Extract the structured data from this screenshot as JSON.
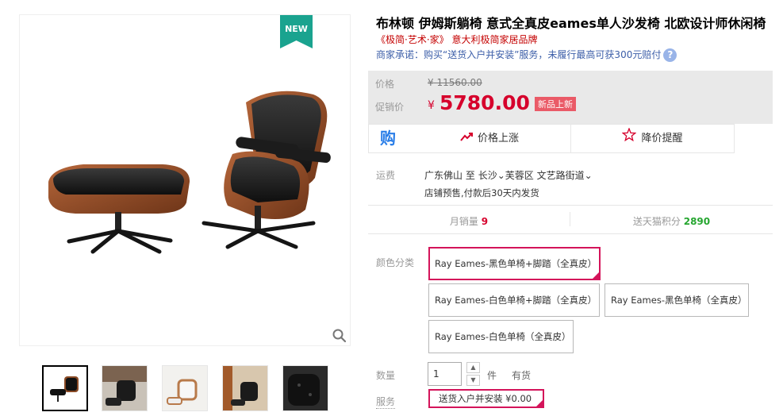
{
  "colors": {
    "accent": "#d4145a",
    "price": "#d6002c",
    "link": "#3c5ea8",
    "badge_bg": "#1aa38f",
    "score": "#26a630"
  },
  "gallery": {
    "badge": "NEW",
    "zoom_icon": "magnifier-icon",
    "thumbnail_count": 5
  },
  "product": {
    "title": "布林顿 伊姆斯躺椅 意式全真皮eames单人沙发椅 北欧设计师休闲椅",
    "subtitle": "《极简·艺术·家》 意大利极简家居品牌",
    "promise": "商家承诺：购买“送货入户并安装”服务，未履行最高可获300元赔付"
  },
  "price": {
    "label": "价格",
    "currency": "¥",
    "original": "11560.00",
    "promo_label": "促销价",
    "promo": "5780.00",
    "tag": "新品上新"
  },
  "actions": {
    "buy_icon": "购",
    "price_up": "价格上涨",
    "remind": "降价提醒"
  },
  "shipping": {
    "label": "运费",
    "origin": "广东佛山",
    "to": "至",
    "city": "长沙",
    "district": "芙蓉区",
    "street": "文艺路街道",
    "note": "店铺预售,付款后30天内发货"
  },
  "stats": {
    "monthly_label": "月销量",
    "monthly_value": "9",
    "points_label": "送天猫积分",
    "points_value": "2890"
  },
  "options": {
    "label": "颜色分类",
    "items": [
      {
        "text": "Ray Eames-黑色单椅+脚踏（全真皮）",
        "selected": true
      },
      {
        "text": "Ray Eames-白色单椅+脚踏（全真皮）",
        "selected": false
      },
      {
        "text": "Ray Eames-黑色单椅（全真皮）",
        "selected": false
      },
      {
        "text": "Ray Eames-白色单椅（全真皮）",
        "selected": false
      }
    ]
  },
  "quantity": {
    "label": "数量",
    "value": "1",
    "unit": "件",
    "stock": "有货"
  },
  "service": {
    "label": "服务",
    "item": "送货入户并安装 ¥0.00"
  }
}
